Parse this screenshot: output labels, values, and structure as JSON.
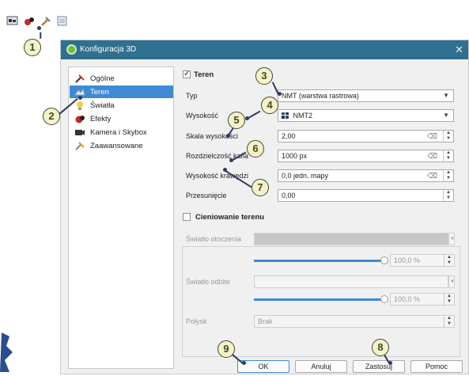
{
  "dialog": {
    "title": "Konfiguracja 3D",
    "close_glyph": "✕"
  },
  "toolbar_icons": [
    "map-canvas-icon",
    "3d-view-icon",
    "tools-icon",
    "settings-icon"
  ],
  "sidebar": {
    "items": [
      {
        "label": "Ogólne",
        "icon": "tools-icon"
      },
      {
        "label": "Teren",
        "icon": "terrain-icon",
        "active": true
      },
      {
        "label": "Światła",
        "icon": "light-bulb-icon"
      },
      {
        "label": "Efekty",
        "icon": "effects-icon"
      },
      {
        "label": "Kamera i Skybox",
        "icon": "camera-icon"
      },
      {
        "label": "Zaawansowane",
        "icon": "advanced-icon"
      }
    ]
  },
  "terrain": {
    "checkbox_checked": true,
    "section_label": "Teren",
    "type_label": "Typ",
    "type_value": "NMT (warstwa rastrowa)",
    "height_label": "Wysokość",
    "height_value": "NMT2",
    "scale_label": "Skala wysokości",
    "scale_value": "2,00",
    "tile_label": "Rozdzielczość kafla",
    "tile_value": "1000 px",
    "edge_label": "Wysokość krawędzi",
    "edge_value": "0,0 jedn. mapy",
    "offset_label": "Przesunięcie",
    "offset_value": "0,00"
  },
  "shading": {
    "checkbox_checked": false,
    "section_label": "Cieniowanie terenu",
    "ambient_label": "Światło otoczenia",
    "ambient_percent": "100,0 %",
    "diffuse_label": "Światło odbite",
    "diffuse_percent": "100,0 %",
    "shine_label": "Połysk",
    "shine_value": "Brak",
    "ambient_slider_fraction": 1.0,
    "diffuse_slider_fraction": 1.0
  },
  "buttons": {
    "ok": "OK",
    "cancel": "Anuluj",
    "apply": "Zastosuj",
    "help": "Pomoc"
  },
  "callouts": [
    "1",
    "2",
    "3",
    "4",
    "5",
    "6",
    "7",
    "8",
    "9"
  ],
  "colors": {
    "accent": "#3c8bd4",
    "titlebar": "#2f6f8f",
    "callout_fill": "#f6f1c9",
    "callout_line": "#2d3b5e"
  }
}
